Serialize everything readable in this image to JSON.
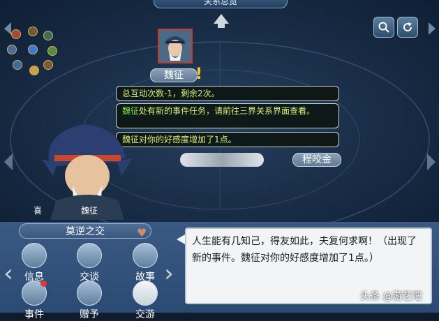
{
  "header": {
    "title": "关系总览"
  },
  "top_buttons": {
    "search_icon": "search-icon",
    "refresh_icon": "refresh-icon"
  },
  "target_npc": {
    "name": "魏征",
    "alert": "!"
  },
  "side_npc": {
    "name": "程咬金"
  },
  "messages": [
    {
      "text": "总互动次数-1，剩余2次。"
    },
    {
      "highlight": "魏征",
      "text": "处有新的事件任务，请前往三界关系界面查看。"
    },
    {
      "text": "魏征对你的好感度增加了1点。"
    }
  ],
  "character": {
    "mood": "喜",
    "name": "魏征"
  },
  "panel": {
    "title": "莫逆之交",
    "actions": [
      {
        "label": "信息",
        "icon": "person-icon",
        "badge": false
      },
      {
        "label": "交谈",
        "icon": "chat-bubble-icon",
        "badge": false
      },
      {
        "label": "故事",
        "icon": "book-icon",
        "badge": false
      },
      {
        "label": "事件",
        "icon": "list-icon",
        "badge": true
      },
      {
        "label": "赠予",
        "icon": "gift-icon",
        "badge": false
      },
      {
        "label": "交游",
        "icon": "bird-icon",
        "badge": false
      }
    ],
    "dialog": "人生能有几知己，得友如此，夫复何求啊！（出现了新的事件。魏征对你的好感度增加了1点。）"
  },
  "watermark": "头条 @游艺吧",
  "colors": {
    "accent_yellow": "#d9f07a",
    "highlight_green": "#7ee84a",
    "panel_blue": "#3a5a84"
  }
}
